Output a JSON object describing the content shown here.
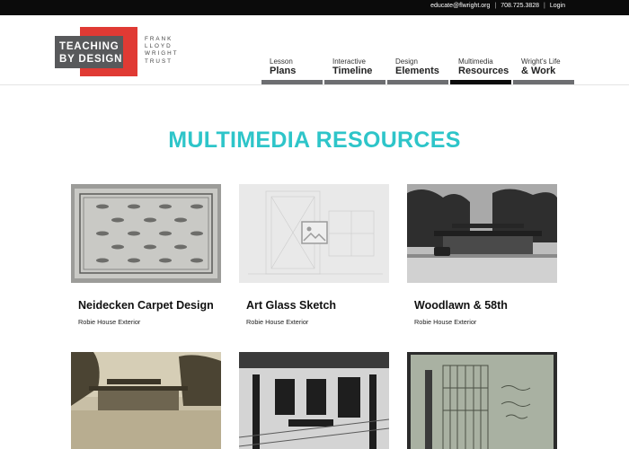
{
  "topbar": {
    "email": "educate@flwright.org",
    "separator": "|",
    "phone": "708.725.3828",
    "login": "Login"
  },
  "logo": {
    "line1": "TEACHING",
    "line2": "BY DESIGN",
    "trust": [
      "FRANK",
      "LLOYD",
      "WRIGHT",
      "TRUST"
    ],
    "colors": {
      "red": "#e03a34",
      "gray": "#58595b"
    }
  },
  "nav": {
    "items": [
      {
        "small": "Lesson",
        "big": "Plans"
      },
      {
        "small": "Interactive",
        "big": "Timeline"
      },
      {
        "small": "Design",
        "big": "Elements"
      },
      {
        "small": "Multimedia",
        "big": "Resources",
        "active": true
      },
      {
        "small": "Wright's Life",
        "big": "& Work"
      }
    ]
  },
  "page": {
    "title": "MULTIMEDIA RESOURCES",
    "accent": "#2ec5c9"
  },
  "cards": [
    {
      "title": "Neidecken Carpet Design",
      "subtitle": "Robie House Exterior",
      "image": "carpet-design-image"
    },
    {
      "title": "Art Glass Sketch",
      "subtitle": "Robie House Exterior",
      "image": "image-placeholder-icon"
    },
    {
      "title": "Woodlawn & 58th",
      "subtitle": "Robie House Exterior",
      "image": "house-photo"
    },
    {
      "title": "",
      "subtitle": "",
      "image": "house-sepia-photo"
    },
    {
      "title": "",
      "subtitle": "",
      "image": "interior-photo"
    },
    {
      "title": "",
      "subtitle": "",
      "image": "sketch-drawing"
    }
  ]
}
